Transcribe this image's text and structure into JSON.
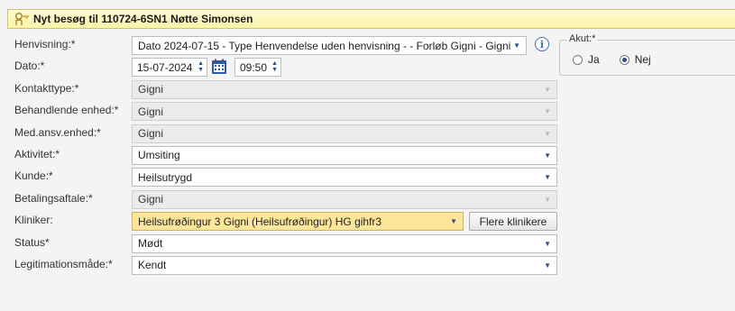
{
  "header": {
    "title": "Nyt besøg til 110724-6SN1 Nøtte Simonsen",
    "icon": "key-person-icon"
  },
  "form": {
    "henvisning": {
      "label": "Henvisning:*",
      "value": "Dato 2024-07-15 - Type Henvendelse uden henvisning -  - Forløb Gigni - Gigni"
    },
    "dato": {
      "label": "Dato:*",
      "date": "15-07-2024",
      "time": "09:50"
    },
    "kontakttype": {
      "label": "Kontakttype:*",
      "value": "Gigni"
    },
    "behandlende": {
      "label": "Behandlende enhed:*",
      "value": "Gigni"
    },
    "medansv": {
      "label": "Med.ansv.enhed:*",
      "value": "Gigni"
    },
    "aktivitet": {
      "label": "Aktivitet:*",
      "value": "Umsiting"
    },
    "kunde": {
      "label": "Kunde:*",
      "value": "Heilsutrygd"
    },
    "betalingsaftale": {
      "label": "Betalingsaftale:*",
      "value": "Gigni"
    },
    "kliniker": {
      "label": "Kliniker:",
      "value": "Heilsufrøðingur 3 Gigni (Heilsufrøðingur) HG gihfr3",
      "button": "Flere klinikere"
    },
    "status": {
      "label": "Status*",
      "value": "Mødt"
    },
    "legitimation": {
      "label": "Legitimationsmåde:*",
      "value": "Kendt"
    }
  },
  "akut": {
    "label": "Akut:*",
    "options": [
      {
        "label": "Ja",
        "checked": false
      },
      {
        "label": "Nej",
        "checked": true
      }
    ]
  },
  "colors": {
    "header_bg": "#fbf3a6",
    "highlight": "#fde69a",
    "accent": "#2c4e86"
  }
}
